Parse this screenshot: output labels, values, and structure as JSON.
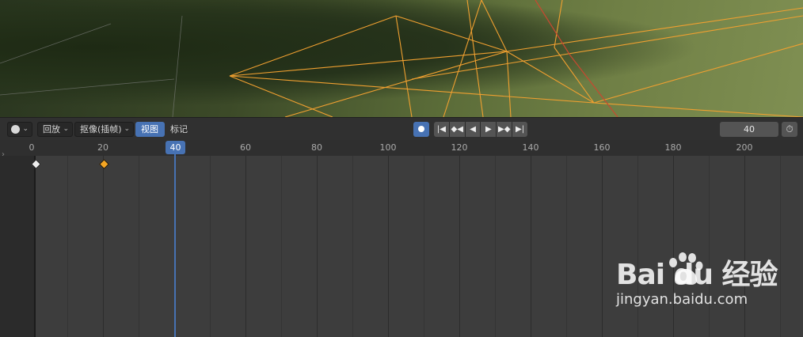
{
  "header": {
    "playback_menu": "回放",
    "keying_menu": "抠像(插帧)",
    "view_menu": "视图",
    "marker_menu": "标记",
    "current_frame_field": "40",
    "editor_type_icon": "clock-icon",
    "timer_icon": "stopwatch-icon"
  },
  "transport": {
    "icons": [
      "jump-start-icon",
      "prev-keyframe-icon",
      "play-reverse-icon",
      "play-icon",
      "next-keyframe-icon",
      "jump-end-icon"
    ],
    "glyphs": [
      "|◀",
      "◆◀",
      "◀",
      "▶",
      "▶◆",
      "▶|"
    ]
  },
  "ruler": {
    "labels": [
      "0",
      "20",
      "40",
      "60",
      "80",
      "100",
      "120",
      "140",
      "160",
      "180",
      "200"
    ],
    "current_frame": "40"
  },
  "keyframes": [
    {
      "frame": 0,
      "state": "unselected"
    },
    {
      "frame": 20,
      "state": "selected"
    }
  ],
  "colors": {
    "accent": "#4772b3",
    "keyframe_selected": "#f5a623",
    "keyframe_unselected": "#eeeeee"
  },
  "watermark": {
    "logo": "Bai du 经验",
    "url": "jingyan.baidu.com"
  }
}
